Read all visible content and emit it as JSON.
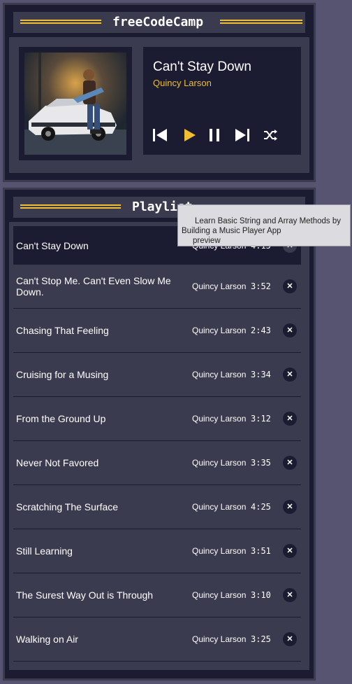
{
  "header": {
    "title": "freeCodeCamp"
  },
  "player": {
    "song_title": "Can't Stay Down",
    "song_artist": "Quincy Larson",
    "controls": [
      "previous-icon",
      "play-icon",
      "pause-icon",
      "next-icon",
      "shuffle-icon"
    ]
  },
  "playlist": {
    "title": "Playlist",
    "songs": [
      {
        "title": "Can't Stay Down",
        "artist": "Quincy Larson",
        "duration": "4:15",
        "delete": "✕"
      },
      {
        "title": "Can't Stop Me. Can't Even Slow Me Down.",
        "artist": "Quincy Larson",
        "duration": "3:52",
        "delete": "✕"
      },
      {
        "title": "Chasing That Feeling",
        "artist": "Quincy Larson",
        "duration": "2:43",
        "delete": "✕"
      },
      {
        "title": "Cruising for a Musing",
        "artist": "Quincy Larson",
        "duration": "3:34",
        "delete": "✕"
      },
      {
        "title": "From the Ground Up",
        "artist": "Quincy Larson",
        "duration": "3:12",
        "delete": "✕"
      },
      {
        "title": "Never Not Favored",
        "artist": "Quincy Larson",
        "duration": "3:35",
        "delete": "✕"
      },
      {
        "title": "Scratching The Surface",
        "artist": "Quincy Larson",
        "duration": "4:25",
        "delete": "✕"
      },
      {
        "title": "Still Learning",
        "artist": "Quincy Larson",
        "duration": "3:51",
        "delete": "✕"
      },
      {
        "title": "The Surest Way Out is Through",
        "artist": "Quincy Larson",
        "duration": "3:10",
        "delete": "✕"
      },
      {
        "title": "Walking on Air",
        "artist": "Quincy Larson",
        "duration": "3:25",
        "delete": "✕"
      }
    ]
  },
  "tooltip": {
    "line1": "Learn Basic String and Array Methods by",
    "line2": "Building a Music Player App",
    "line3": "preview"
  },
  "colors": {
    "accent": "#f1be32",
    "dark": "#1b1b32",
    "panel": "#3b3b4f",
    "background": "#565470"
  }
}
